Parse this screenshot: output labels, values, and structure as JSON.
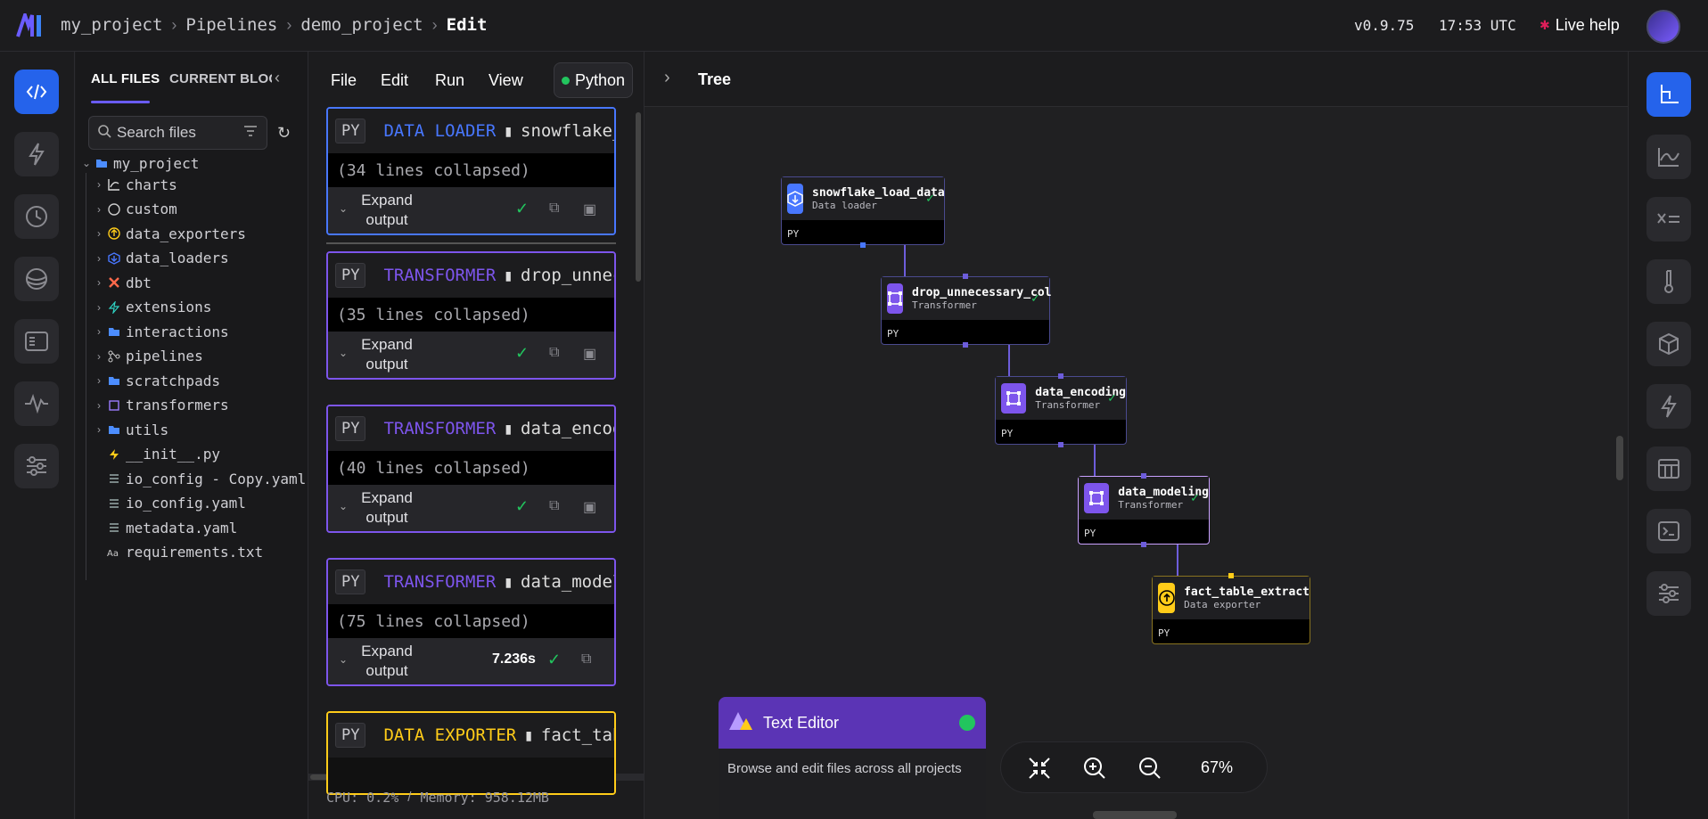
{
  "header": {
    "breadcrumb": [
      "my_project",
      "Pipelines",
      "demo_project",
      "Edit"
    ],
    "version": "v0.9.75",
    "time": "17:53 UTC",
    "live_help": "Live help"
  },
  "file_panel": {
    "tabs": [
      "ALL FILES",
      "CURRENT BLOCK"
    ],
    "search_placeholder": "Search files",
    "root": "my_project",
    "items": [
      {
        "label": "charts",
        "icon": "chart-icon",
        "kind": "folder"
      },
      {
        "label": "custom",
        "icon": "custom-icon",
        "kind": "folder"
      },
      {
        "label": "data_exporters",
        "icon": "exporter-icon",
        "kind": "folder"
      },
      {
        "label": "data_loaders",
        "icon": "loader-icon",
        "kind": "folder"
      },
      {
        "label": "dbt",
        "icon": "dbt-icon",
        "kind": "folder"
      },
      {
        "label": "extensions",
        "icon": "extension-icon",
        "kind": "folder"
      },
      {
        "label": "interactions",
        "icon": "folder-icon",
        "kind": "folder"
      },
      {
        "label": "pipelines",
        "icon": "pipeline-icon",
        "kind": "folder"
      },
      {
        "label": "scratchpads",
        "icon": "folder-icon",
        "kind": "folder"
      },
      {
        "label": "transformers",
        "icon": "transformer-icon",
        "kind": "folder"
      },
      {
        "label": "utils",
        "icon": "folder-icon",
        "kind": "folder"
      },
      {
        "label": "__init__.py",
        "icon": "python-icon",
        "kind": "file"
      },
      {
        "label": "io_config - Copy.yaml",
        "icon": "yaml-icon",
        "kind": "file"
      },
      {
        "label": "io_config.yaml",
        "icon": "yaml-icon",
        "kind": "file"
      },
      {
        "label": "metadata.yaml",
        "icon": "yaml-icon",
        "kind": "file"
      },
      {
        "label": "requirements.txt",
        "icon": "text-icon",
        "kind": "file"
      }
    ]
  },
  "editor": {
    "menu": [
      "File",
      "Edit",
      "Run",
      "View"
    ],
    "language": "Python",
    "blocks": [
      {
        "lang": "PY",
        "type": "DATA LOADER",
        "color": "#4877ff",
        "file": "snowflake_load_data",
        "collapsed": "(34 lines collapsed)",
        "expand": "Expand output",
        "time": ""
      },
      {
        "lang": "PY",
        "type": "TRANSFORMER",
        "color": "#7d55ec",
        "file": "drop_unnecessary_col",
        "collapsed": "(35 lines collapsed)",
        "expand": "Expand output",
        "time": ""
      },
      {
        "lang": "PY",
        "type": "TRANSFORMER",
        "color": "#7d55ec",
        "file": "data_encoding",
        "collapsed": "(40 lines collapsed)",
        "expand": "Expand output",
        "time": ""
      },
      {
        "lang": "PY",
        "type": "TRANSFORMER",
        "color": "#7d55ec",
        "file": "data_modeling",
        "collapsed": "(75 lines collapsed)",
        "expand": "Expand output",
        "time": "7.236s"
      },
      {
        "lang": "PY",
        "type": "DATA EXPORTER",
        "color": "#ffcc19",
        "file": "fact_table_extract",
        "collapsed": "",
        "expand": "",
        "time": ""
      }
    ],
    "status": {
      "cpu": "CPU: 0.2%",
      "sep": "/",
      "memory": "Memory: 958.12MB"
    }
  },
  "tree": {
    "title": "Tree",
    "nodes": [
      {
        "name": "snowflake_load_data",
        "type": "Data loader",
        "lang": "PY",
        "color": "#4877ff"
      },
      {
        "name": "drop_unnecessary_col",
        "type": "Transformer",
        "lang": "PY",
        "color": "#7d55ec"
      },
      {
        "name": "data_encoding",
        "type": "Transformer",
        "lang": "PY",
        "color": "#7d55ec"
      },
      {
        "name": "data_modeling",
        "type": "Transformer",
        "lang": "PY",
        "color": "#7d55ec"
      },
      {
        "name": "fact_table_extract",
        "type": "Data exporter",
        "lang": "PY",
        "color": "#ffcc19"
      }
    ],
    "zoom": "67%"
  },
  "text_editor_popup": {
    "title": "Text Editor",
    "description": "Browse and edit files across all projects"
  },
  "colors": {
    "accent": "#2563eb",
    "success": "#22c55e",
    "purple": "#7d55ec",
    "yellow": "#ffcc19",
    "blue": "#4877ff"
  }
}
